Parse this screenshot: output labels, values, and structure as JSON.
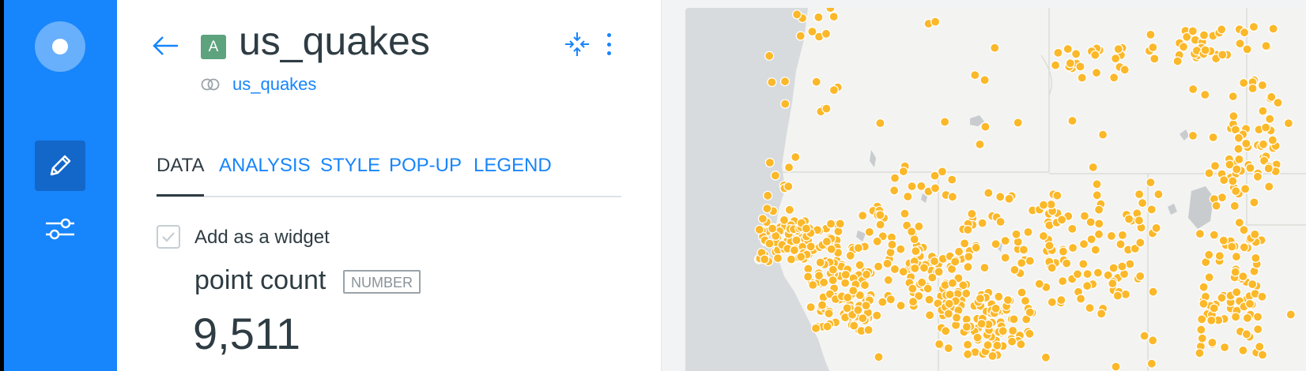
{
  "layer": {
    "type_badge": "A",
    "title": "us_quakes",
    "source": "us_quakes"
  },
  "tabs": [
    {
      "label": "DATA",
      "active": true
    },
    {
      "label": "ANALYSIS",
      "active": false
    },
    {
      "label": "STYLE",
      "active": false
    },
    {
      "label": "POP-UP",
      "active": false
    },
    {
      "label": "LEGEND",
      "active": false
    }
  ],
  "widget": {
    "checkbox_label": "Add as a widget",
    "checked": true,
    "metric_name": "point count",
    "metric_type": "NUMBER",
    "metric_value": "9,511"
  },
  "icons": {
    "logo": "carto-logo-icon",
    "edit": "pencil-icon",
    "settings": "sliders-icon",
    "back": "arrow-left-icon",
    "collapse": "collapse-icon",
    "more": "more-vertical-icon",
    "source": "source-node-icon",
    "check": "check-icon"
  },
  "colors": {
    "sidebar": "#1785fb",
    "accent": "#1785fb",
    "badge": "#5ca37e",
    "point": "#fbb829",
    "ocean": "#d7dbde",
    "land": "#f3f3f1"
  }
}
